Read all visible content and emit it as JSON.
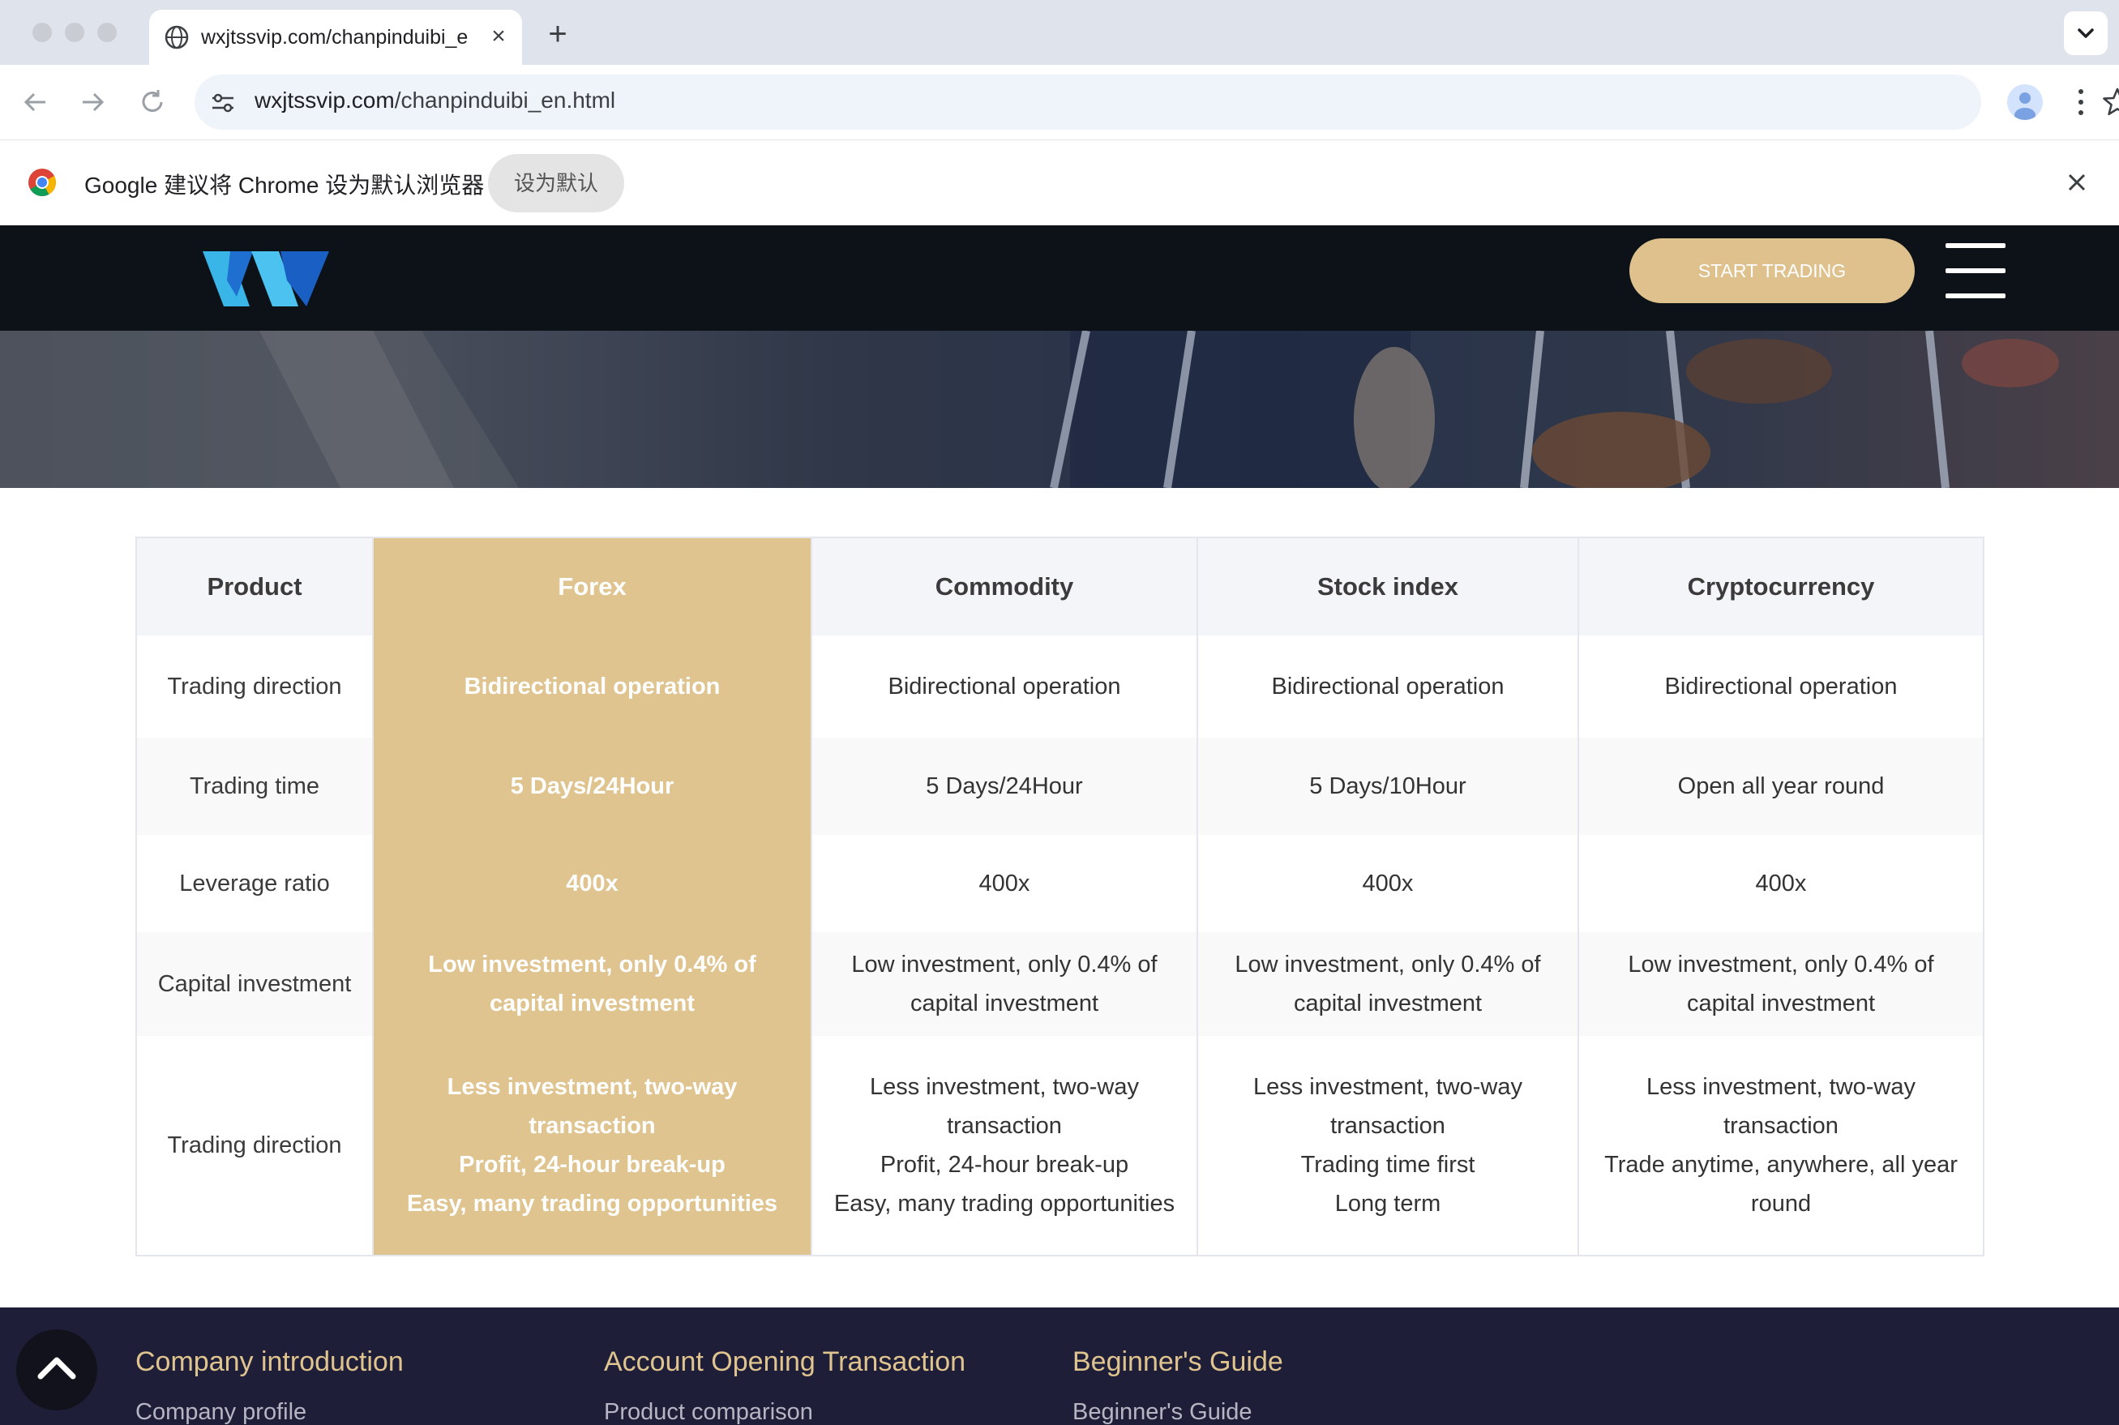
{
  "browser": {
    "tab_title": "wxjtssvip.com/chanpinduibi_en.html",
    "tab_close": "×",
    "new_tab": "+",
    "url_domain": "wxjtssvip.com",
    "url_path": "/chanpinduibi_en.html",
    "infobar_text": "Google 建议将 Chrome 设为默认浏览器",
    "infobar_button": "设为默认"
  },
  "header": {
    "start_trading": "START TRADING"
  },
  "table": {
    "columns": [
      "Product",
      "Forex",
      "Commodity",
      "Stock index",
      "Cryptocurrency"
    ],
    "rows": [
      {
        "label": "Trading direction",
        "cells": [
          "Bidirectional operation",
          "Bidirectional operation",
          "Bidirectional operation",
          "Bidirectional operation"
        ]
      },
      {
        "label": "Trading time",
        "cells": [
          "5 Days/24Hour",
          "5 Days/24Hour",
          "5 Days/10Hour",
          "Open all year round"
        ]
      },
      {
        "label": "Leverage ratio",
        "cells": [
          "400x",
          "400x",
          "400x",
          "400x"
        ]
      },
      {
        "label": "Capital investment",
        "cells": [
          "Low investment, only 0.4% of capital investment",
          "Low investment, only 0.4% of capital investment",
          "Low investment, only 0.4% of capital investment",
          "Low investment, only 0.4% of capital investment"
        ]
      },
      {
        "label": "Trading direction",
        "cells": [
          [
            "Less investment, two-way transaction",
            "Profit, 24-hour break-up",
            "Easy, many trading opportunities"
          ],
          [
            "Less investment, two-way transaction",
            "Profit, 24-hour break-up",
            "Easy, many trading opportunities"
          ],
          [
            "Less investment, two-way transaction",
            "Trading time first",
            "Long term"
          ],
          [
            "Less investment, two-way transaction",
            "Trade anytime, anywhere, all year round"
          ]
        ]
      }
    ]
  },
  "footer": {
    "columns": [
      {
        "heading": "Company introduction",
        "first_link": "Company profile"
      },
      {
        "heading": "Account Opening Transaction",
        "first_link": "Product comparison"
      },
      {
        "heading": "Beginner's Guide",
        "first_link": "Beginner's Guide"
      }
    ]
  },
  "colors": {
    "accent_gold": "#dfc48f",
    "header_bg": "#0d1219",
    "footer_bg": "#1f1e38",
    "footer_heading": "#dfc48f"
  },
  "icons": [
    "globe-icon",
    "close-icon",
    "plus-icon",
    "chevron-down-icon",
    "back-icon",
    "forward-icon",
    "reload-icon",
    "site-info-icon",
    "star-icon",
    "profile-icon",
    "kebab-menu-icon",
    "chrome-logo-icon",
    "hamburger-menu-icon",
    "chevron-up-icon"
  ]
}
